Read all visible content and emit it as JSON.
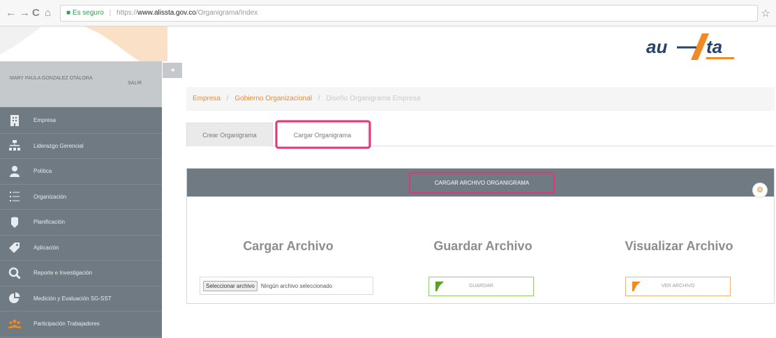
{
  "browser": {
    "back_label": "←",
    "forward_label": "→",
    "reload_label": "C",
    "home_label": "⌂",
    "secure_text": "Es seguro",
    "url_protocol": "https://",
    "url_host": "www.alissta.gov.co",
    "url_path": "/Organigrama/Index",
    "bookmark_label": "☆"
  },
  "brand": {
    "logo_text": "ALISSTA"
  },
  "user": {
    "name": "MARY PAULA GONZALEZ OTALORA",
    "logout_label": "SALIR"
  },
  "sidebar": {
    "collapse_label": "◂",
    "items": [
      {
        "label": "Empresa",
        "icon": "building-icon"
      },
      {
        "label": "Liderazgo Gerencial",
        "icon": "sitemap-icon"
      },
      {
        "label": "Política",
        "icon": "user-icon"
      },
      {
        "label": "Organización",
        "icon": "list-icon"
      },
      {
        "label": "Planificación",
        "icon": "clipboard-icon"
      },
      {
        "label": "Aplicación",
        "icon": "tag-icon"
      },
      {
        "label": "Reporte e Investigación",
        "icon": "search-icon"
      },
      {
        "label": "Medición y Evaluación SG-SST",
        "icon": "pie-chart-icon"
      },
      {
        "label": "Participación Trabajadores",
        "icon": "group-icon"
      }
    ]
  },
  "breadcrumb": {
    "items": [
      "Empresa",
      "Gobierno Organizacional",
      "Diseño Organigrama Empresa"
    ],
    "separator": "/"
  },
  "tabs": [
    {
      "label": "Crear Organigrama"
    },
    {
      "label": "Cargar Organigrama"
    }
  ],
  "panel": {
    "title": "CARGAR ARCHIVO ORGANIGRAMA",
    "settings_icon": "gear-icon",
    "columns": [
      {
        "title": "Cargar Archivo"
      },
      {
        "title": "Guardar Archivo"
      },
      {
        "title": "Visualizar Archivo"
      }
    ],
    "file_button_label": "Seleccionar archivo",
    "file_status": "Ningún archivo seleccionado",
    "save_button_label": "GUARDAR",
    "view_button_label": "VER ARCHIVO"
  },
  "colors": {
    "accent_orange": "#f08a24",
    "sidebar_bg": "#6f7a82",
    "highlight_pink": "#e2347a",
    "save_green": "#5aa02c",
    "view_orange": "#f08a24"
  }
}
